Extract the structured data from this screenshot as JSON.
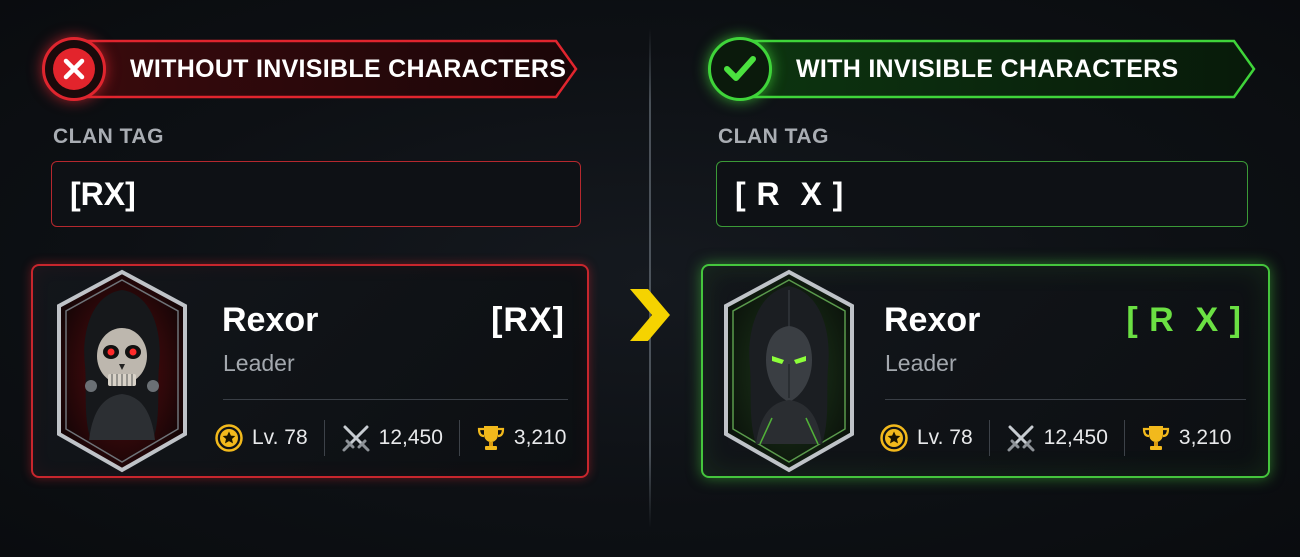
{
  "colors": {
    "bad": "#e0252e",
    "good": "#3fd43a",
    "good_tag": "#6be043",
    "arrow": "#f5d300",
    "gold": "#f2b91c"
  },
  "left": {
    "header_title": "WITHOUT INVISIBLE CHARACTERS",
    "header_icon": "x-icon",
    "field_label": "CLAN TAG",
    "tag_value": "[RX]",
    "card": {
      "name": "Rexor",
      "role": "Leader",
      "tag": "[RX]",
      "level": "Lv. 78",
      "power": "12,450",
      "trophies": "3,210"
    }
  },
  "right": {
    "header_title": "WITH INVISIBLE CHARACTERS",
    "header_icon": "check-icon",
    "field_label": "CLAN TAG",
    "tag_value": "[ R  X ]",
    "card": {
      "name": "Rexor",
      "role": "Leader",
      "tag": "[ R  X ]",
      "level": "Lv. 78",
      "power": "12,450",
      "trophies": "3,210"
    }
  },
  "icons": {
    "level": "star-coin-icon",
    "power": "crossed-swords-icon",
    "trophies": "trophy-icon",
    "divider_arrow": "chevron-right-icon"
  }
}
